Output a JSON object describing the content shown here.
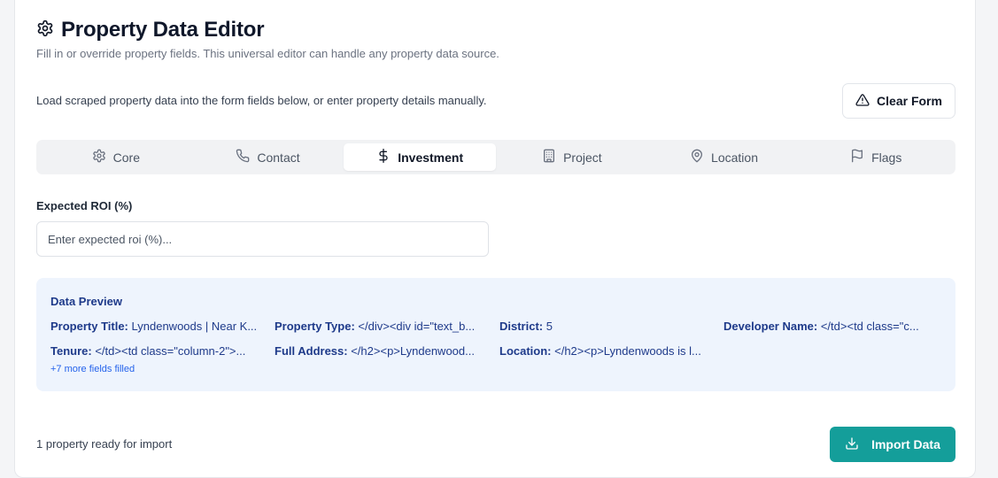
{
  "header": {
    "title": "Property Data Editor",
    "subtitle": "Fill in or override property fields. This universal editor can handle any property data source.",
    "title_icon": "gear-icon"
  },
  "toolbar": {
    "instructions": "Load scraped property data into the form fields below, or enter property details manually.",
    "clear_label": "Clear Form",
    "clear_icon": "warning-triangle-icon"
  },
  "tabs": [
    {
      "label": "Core",
      "icon": "gear-icon",
      "active": false
    },
    {
      "label": "Contact",
      "icon": "phone-icon",
      "active": false
    },
    {
      "label": "Investment",
      "icon": "dollar-icon",
      "active": true
    },
    {
      "label": "Project",
      "icon": "building-icon",
      "active": false
    },
    {
      "label": "Location",
      "icon": "map-pin-icon",
      "active": false
    },
    {
      "label": "Flags",
      "icon": "flag-icon",
      "active": false
    }
  ],
  "form": {
    "roi_label": "Expected ROI (%)",
    "roi_placeholder": "Enter expected roi (%)...",
    "roi_value": ""
  },
  "preview": {
    "title": "Data Preview",
    "fields": [
      {
        "key": "Property Title:",
        "value": "Lyndenwoods | Near K..."
      },
      {
        "key": "Property Type:",
        "value": "</div><div id=\"text_b..."
      },
      {
        "key": "District:",
        "value": "5"
      },
      {
        "key": "Developer Name:",
        "value": "</td><td class=\"c..."
      },
      {
        "key": "Tenure:",
        "value": "</td><td class=\"column-2\">..."
      },
      {
        "key": "Full Address:",
        "value": "</h2><p>Lyndenwood..."
      },
      {
        "key": "Location:",
        "value": "</h2><p>Lyndenwoods is l..."
      }
    ],
    "more": "+7 more fields filled"
  },
  "footer": {
    "status": "1 property ready for import",
    "import_label": "Import Data",
    "import_icon": "download-icon"
  },
  "colors": {
    "accent": "#149e9a",
    "preview_bg": "#eef4fd",
    "preview_text": "#1e3a8a"
  }
}
